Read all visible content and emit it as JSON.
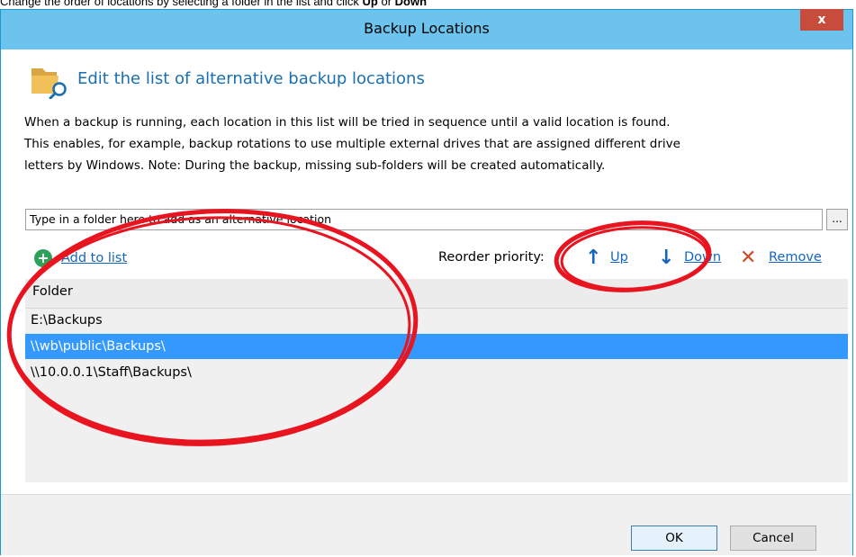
{
  "caption": {
    "part1": "Change the order of locations by selecting a folder in the list and click ",
    "up": "Up",
    "or": " or ",
    "down": "Down"
  },
  "window": {
    "title": "Backup Locations",
    "close_label": "x"
  },
  "heading": "Edit the list of alternative backup locations",
  "description": {
    "line1": "When a backup is running, each location in this list will be tried in sequence until a valid location is found.",
    "line2": "This enables, for example, backup rotations to use multiple external drives that are assigned different drive",
    "line3": "letters by Windows.   Note: During the backup, missing sub-folders will be created automatically."
  },
  "path_input": {
    "placeholder": "Type in a folder here to add as an alternative location",
    "browse_label": "..."
  },
  "toolbar": {
    "add_label": "Add to list",
    "reorder_label": "Reorder priority:",
    "up_label": "Up",
    "down_label": "Down",
    "remove_label": "Remove"
  },
  "grid": {
    "column_header": "Folder",
    "rows": [
      {
        "folder": "E:\\Backups",
        "selected": false
      },
      {
        "folder": "\\\\wb\\public\\Backups\\",
        "selected": true
      },
      {
        "folder": "\\\\10.0.0.1\\Staff\\Backups\\",
        "selected": false
      }
    ]
  },
  "buttons": {
    "ok": "OK",
    "cancel": "Cancel"
  },
  "colors": {
    "titlebar": "#6cc4ee",
    "close": "#c74c3c",
    "heading": "#1a6fb0",
    "link": "#1565c0",
    "selected_row": "#3399ff",
    "annotation": "#e8141f"
  },
  "icons": {
    "heading": "folder-search-icon",
    "add": "add-icon",
    "up": "arrow-up-icon",
    "down": "arrow-down-icon",
    "remove": "remove-icon"
  }
}
